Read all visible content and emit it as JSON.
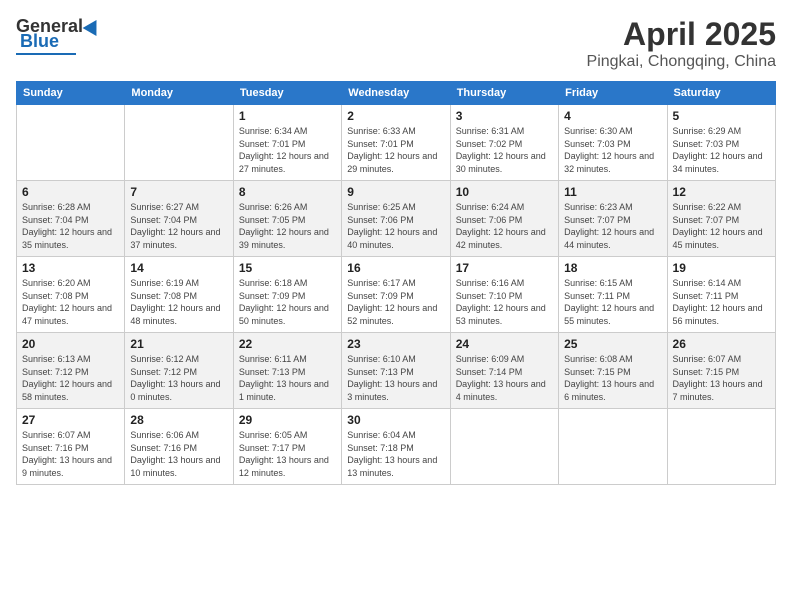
{
  "header": {
    "logo_general": "General",
    "logo_blue": "Blue",
    "month": "April 2025",
    "location": "Pingkai, Chongqing, China"
  },
  "days_of_week": [
    "Sunday",
    "Monday",
    "Tuesday",
    "Wednesday",
    "Thursday",
    "Friday",
    "Saturday"
  ],
  "weeks": [
    [
      {
        "day": "",
        "info": ""
      },
      {
        "day": "",
        "info": ""
      },
      {
        "day": "1",
        "info": "Sunrise: 6:34 AM\nSunset: 7:01 PM\nDaylight: 12 hours and 27 minutes."
      },
      {
        "day": "2",
        "info": "Sunrise: 6:33 AM\nSunset: 7:01 PM\nDaylight: 12 hours and 29 minutes."
      },
      {
        "day": "3",
        "info": "Sunrise: 6:31 AM\nSunset: 7:02 PM\nDaylight: 12 hours and 30 minutes."
      },
      {
        "day": "4",
        "info": "Sunrise: 6:30 AM\nSunset: 7:03 PM\nDaylight: 12 hours and 32 minutes."
      },
      {
        "day": "5",
        "info": "Sunrise: 6:29 AM\nSunset: 7:03 PM\nDaylight: 12 hours and 34 minutes."
      }
    ],
    [
      {
        "day": "6",
        "info": "Sunrise: 6:28 AM\nSunset: 7:04 PM\nDaylight: 12 hours and 35 minutes."
      },
      {
        "day": "7",
        "info": "Sunrise: 6:27 AM\nSunset: 7:04 PM\nDaylight: 12 hours and 37 minutes."
      },
      {
        "day": "8",
        "info": "Sunrise: 6:26 AM\nSunset: 7:05 PM\nDaylight: 12 hours and 39 minutes."
      },
      {
        "day": "9",
        "info": "Sunrise: 6:25 AM\nSunset: 7:06 PM\nDaylight: 12 hours and 40 minutes."
      },
      {
        "day": "10",
        "info": "Sunrise: 6:24 AM\nSunset: 7:06 PM\nDaylight: 12 hours and 42 minutes."
      },
      {
        "day": "11",
        "info": "Sunrise: 6:23 AM\nSunset: 7:07 PM\nDaylight: 12 hours and 44 minutes."
      },
      {
        "day": "12",
        "info": "Sunrise: 6:22 AM\nSunset: 7:07 PM\nDaylight: 12 hours and 45 minutes."
      }
    ],
    [
      {
        "day": "13",
        "info": "Sunrise: 6:20 AM\nSunset: 7:08 PM\nDaylight: 12 hours and 47 minutes."
      },
      {
        "day": "14",
        "info": "Sunrise: 6:19 AM\nSunset: 7:08 PM\nDaylight: 12 hours and 48 minutes."
      },
      {
        "day": "15",
        "info": "Sunrise: 6:18 AM\nSunset: 7:09 PM\nDaylight: 12 hours and 50 minutes."
      },
      {
        "day": "16",
        "info": "Sunrise: 6:17 AM\nSunset: 7:09 PM\nDaylight: 12 hours and 52 minutes."
      },
      {
        "day": "17",
        "info": "Sunrise: 6:16 AM\nSunset: 7:10 PM\nDaylight: 12 hours and 53 minutes."
      },
      {
        "day": "18",
        "info": "Sunrise: 6:15 AM\nSunset: 7:11 PM\nDaylight: 12 hours and 55 minutes."
      },
      {
        "day": "19",
        "info": "Sunrise: 6:14 AM\nSunset: 7:11 PM\nDaylight: 12 hours and 56 minutes."
      }
    ],
    [
      {
        "day": "20",
        "info": "Sunrise: 6:13 AM\nSunset: 7:12 PM\nDaylight: 12 hours and 58 minutes."
      },
      {
        "day": "21",
        "info": "Sunrise: 6:12 AM\nSunset: 7:12 PM\nDaylight: 13 hours and 0 minutes."
      },
      {
        "day": "22",
        "info": "Sunrise: 6:11 AM\nSunset: 7:13 PM\nDaylight: 13 hours and 1 minute."
      },
      {
        "day": "23",
        "info": "Sunrise: 6:10 AM\nSunset: 7:13 PM\nDaylight: 13 hours and 3 minutes."
      },
      {
        "day": "24",
        "info": "Sunrise: 6:09 AM\nSunset: 7:14 PM\nDaylight: 13 hours and 4 minutes."
      },
      {
        "day": "25",
        "info": "Sunrise: 6:08 AM\nSunset: 7:15 PM\nDaylight: 13 hours and 6 minutes."
      },
      {
        "day": "26",
        "info": "Sunrise: 6:07 AM\nSunset: 7:15 PM\nDaylight: 13 hours and 7 minutes."
      }
    ],
    [
      {
        "day": "27",
        "info": "Sunrise: 6:07 AM\nSunset: 7:16 PM\nDaylight: 13 hours and 9 minutes."
      },
      {
        "day": "28",
        "info": "Sunrise: 6:06 AM\nSunset: 7:16 PM\nDaylight: 13 hours and 10 minutes."
      },
      {
        "day": "29",
        "info": "Sunrise: 6:05 AM\nSunset: 7:17 PM\nDaylight: 13 hours and 12 minutes."
      },
      {
        "day": "30",
        "info": "Sunrise: 6:04 AM\nSunset: 7:18 PM\nDaylight: 13 hours and 13 minutes."
      },
      {
        "day": "",
        "info": ""
      },
      {
        "day": "",
        "info": ""
      },
      {
        "day": "",
        "info": ""
      }
    ]
  ]
}
